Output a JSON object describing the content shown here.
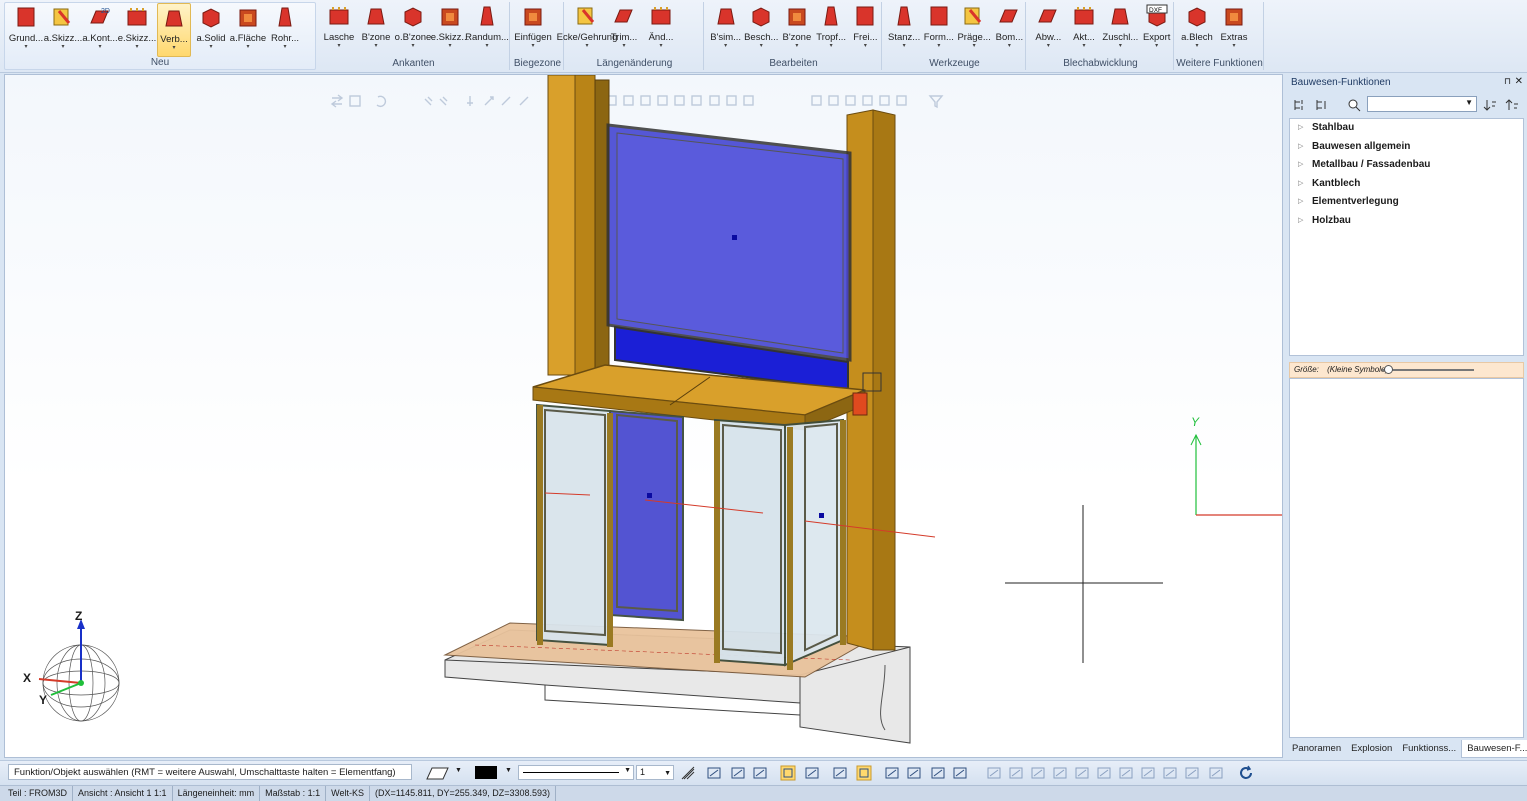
{
  "ribbon": {
    "groups": [
      {
        "title": "Neu",
        "buttons": [
          "Grund...",
          "a.Skizz...",
          "a.Kont...",
          "e.Skizz...",
          "Verb...",
          "a.Solid",
          "a.Fläche",
          "Rohr..."
        ]
      },
      {
        "title": "Ankanten",
        "buttons": [
          "Lasche",
          "B'zone",
          "o.B'zone",
          "e.Skizz...",
          "Randum..."
        ]
      },
      {
        "title": "Biegezone",
        "buttons": [
          "Einfügen"
        ]
      },
      {
        "title": "Längenänderung",
        "buttons": [
          "Ecke/Gehrung",
          "Trim...",
          "Änd..."
        ]
      },
      {
        "title": "Bearbeiten",
        "buttons": [
          "B'sim...",
          "Besch...",
          "B'zone",
          "Tropf...",
          "Frei..."
        ]
      },
      {
        "title": "Werkzeuge",
        "buttons": [
          "Stanz...",
          "Form...",
          "Präge...",
          "Bom..."
        ]
      },
      {
        "title": "Blechabwicklung",
        "buttons": [
          "Abw...",
          "Akt...",
          "Zuschl...",
          "Export"
        ]
      },
      {
        "title": "Weitere Funktionen",
        "buttons": [
          "a.Blech",
          "Extras"
        ]
      }
    ],
    "badges": {
      "kontur": "2D",
      "export": "DXF"
    }
  },
  "viewport": {
    "axis_labels": {
      "x": "X",
      "y": "Y",
      "z": "Z",
      "scene_y": "Y"
    }
  },
  "panel": {
    "title": "Bauwesen-Funktionen",
    "pin": "⊓",
    "close": "✕",
    "tree": [
      "Stahlbau",
      "Bauwesen allgemein",
      "Metallbau / Fassadenbau",
      "Kantblech",
      "Elementverlegung",
      "Holzbau"
    ],
    "size_label": "Größe:",
    "size_value": "(Kleine Symbole)",
    "tabs": [
      "Panoramen",
      "Explosion",
      "Funktionss...",
      "Bauwesen-F..."
    ]
  },
  "toolbar": {
    "prompt": "Funktion/Objekt auswählen (RMT = weitere Auswahl, Umschalttaste halten = Elementfang)",
    "line_number": "1"
  },
  "status": [
    "Teil : FROM3D",
    "Ansicht : Ansicht 1 1:1",
    "Längeneinheit: mm",
    "Maßstab : 1:1",
    "Welt-KS",
    "(DX=1145.811, DY=255.349, DZ=3308.593)"
  ],
  "colors": {
    "accent": "#ffd86e",
    "steel_blue": "#3a3bd0",
    "wood": "#d9a02b",
    "red_icon": "#d9342b"
  }
}
